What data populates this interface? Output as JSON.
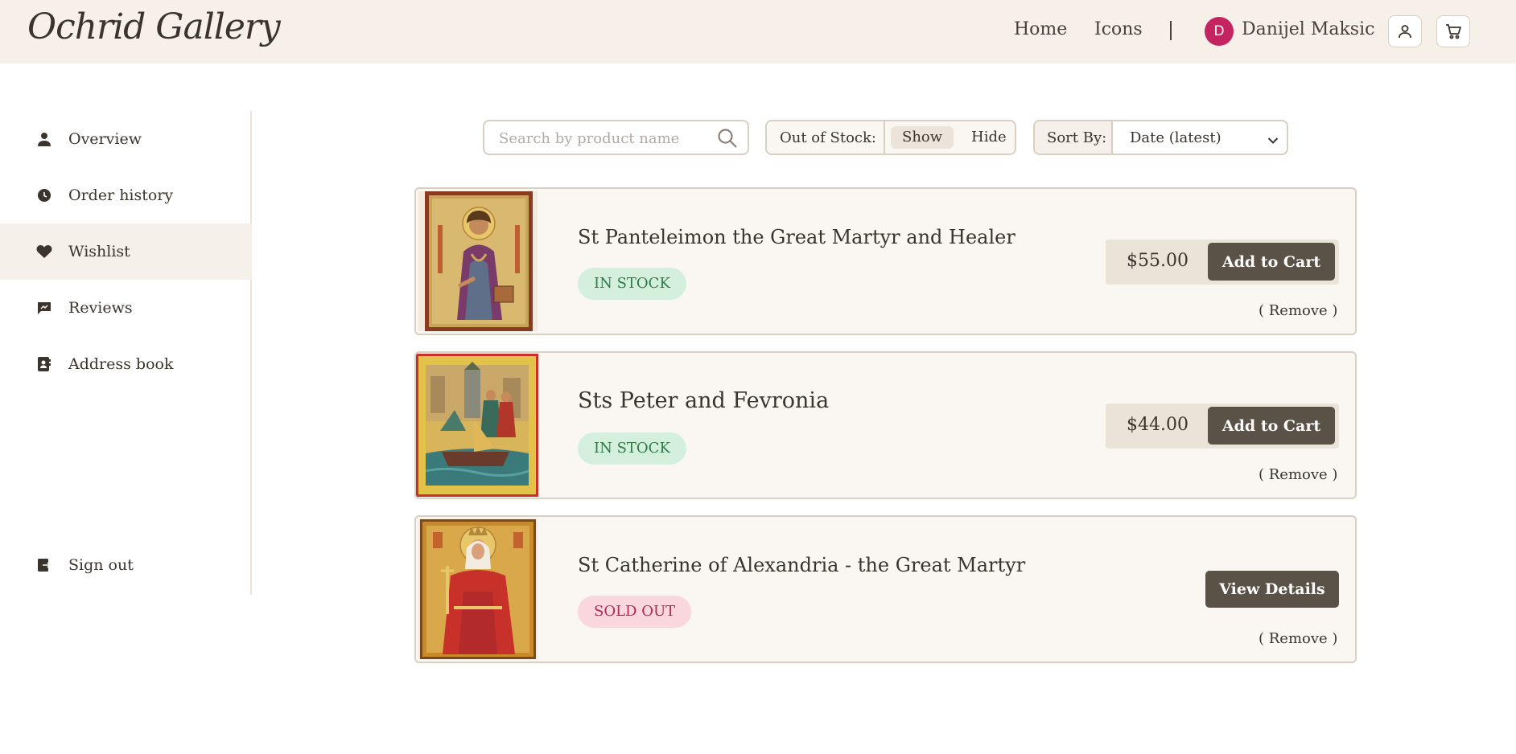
{
  "header": {
    "logo": "Ochrid Gallery",
    "nav": {
      "home": "Home",
      "icons": "Icons"
    },
    "user": {
      "initial": "D",
      "name": "Danijel Maksic"
    }
  },
  "sidebar": {
    "items": [
      {
        "label": "Overview",
        "icon": "user-icon"
      },
      {
        "label": "Order history",
        "icon": "history-icon"
      },
      {
        "label": "Wishlist",
        "icon": "heart-icon",
        "active": true
      },
      {
        "label": "Reviews",
        "icon": "review-icon"
      },
      {
        "label": "Address book",
        "icon": "address-book-icon"
      }
    ],
    "signout": {
      "label": "Sign out",
      "icon": "sign-out-icon"
    }
  },
  "filters": {
    "search": {
      "placeholder": "Search by product name",
      "value": ""
    },
    "stock": {
      "label": "Out of Stock:",
      "show": "Show",
      "hide": "Hide",
      "selected": "Show"
    },
    "sort": {
      "label": "Sort By:",
      "value": "Date (latest)"
    }
  },
  "wishlist": [
    {
      "title": "St Panteleimon the Great Martyr and Healer",
      "status": "IN STOCK",
      "price": "$55.00",
      "action": "Add to Cart",
      "remove": "( Remove )"
    },
    {
      "title": "Sts Peter and Fevronia",
      "status": "IN STOCK",
      "price": "$44.00",
      "action": "Add to Cart",
      "remove": "( Remove )"
    },
    {
      "title": "St Catherine of Alexandria - the Great Martyr",
      "status": "SOLD OUT",
      "action": "View Details",
      "remove": "( Remove )"
    }
  ],
  "colors": {
    "header_bg": "#f6f0e8",
    "button_bg": "#5a5147",
    "in_stock_bg": "#d4f0dc",
    "in_stock_text": "#2e7a4a",
    "sold_out_bg": "#fad6df",
    "sold_out_text": "#b02a4d",
    "avatar_bg": "#c4245f"
  }
}
